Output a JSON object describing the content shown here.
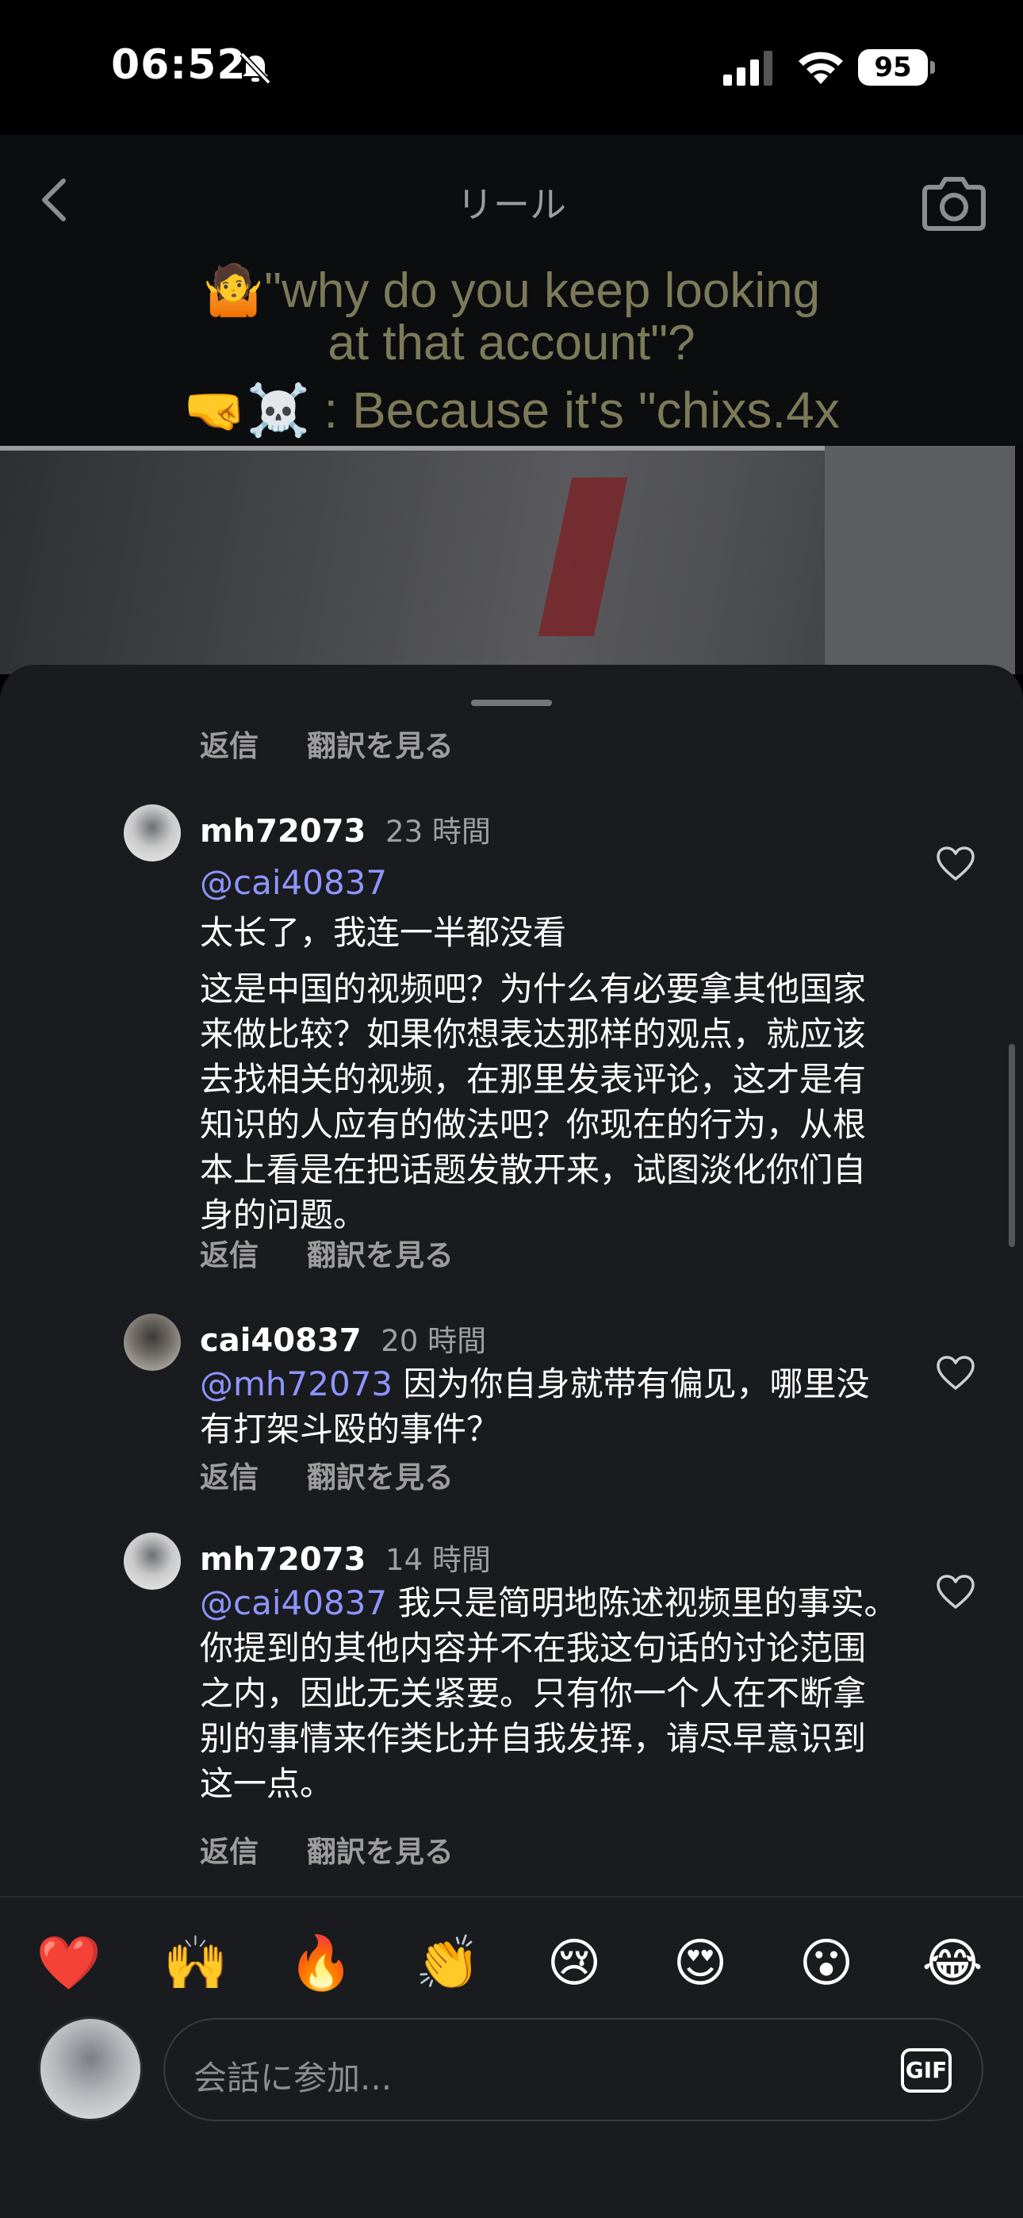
{
  "status": {
    "time": "06:52",
    "battery": "95"
  },
  "reel": {
    "title": "リール",
    "caption_line1": "🤷\"why  do you  keep looking",
    "caption_line2": "at that account\"?",
    "caption_line3": "🤜☠️ : Because it's \"chixs.4x"
  },
  "comments": {
    "top_reply": "返信",
    "top_translate": "翻訳を見る",
    "items": [
      {
        "username": "mh72073",
        "time": "23 時間",
        "mention": "@cai40837",
        "text_line": "",
        "paragraphs": [
          "太长了，我连一半都没看",
          "这是中国的视频吧？为什么有必要拿其他国家来做比较？如果你想表达那样的观点，就应该去找相关的视频，在那里发表评论，这才是有知识的人应有的做法吧？你现在的行为，从根本上看是在把话题发散开来，试图淡化你们自身的问题。"
        ],
        "reply": "返信",
        "translate": "翻訳を見る"
      },
      {
        "username": "cai40837",
        "time": "20 時間",
        "mention": "@mh72073",
        "text_line": " 因为你自身就带有偏见，哪里没有打架斗殴的事件？",
        "reply": "返信",
        "translate": "翻訳を見る"
      },
      {
        "username": "mh72073",
        "time": "14 時間",
        "mention": "@cai40837",
        "text_line": " 我只是简明地陈述视频里的事实。你提到的其他内容并不在我这句话的讨论范围之内，因此无关紧要。只有你一个人在不断拿别的事情来作类比并自我发挥，请尽早意识到这一点。",
        "reply": "返信",
        "translate": "翻訳を見る"
      }
    ]
  },
  "reactions": [
    "❤️",
    "🙌",
    "🔥",
    "👏",
    "😢",
    "😍",
    "😮",
    "😂"
  ],
  "composer": {
    "placeholder": "会話に参加...",
    "gif_label": "GIF"
  },
  "colors": {
    "sheet_bg": "#1a1b1f",
    "mention": "#8f95ff",
    "secondary_text": "#9d9d9d"
  }
}
